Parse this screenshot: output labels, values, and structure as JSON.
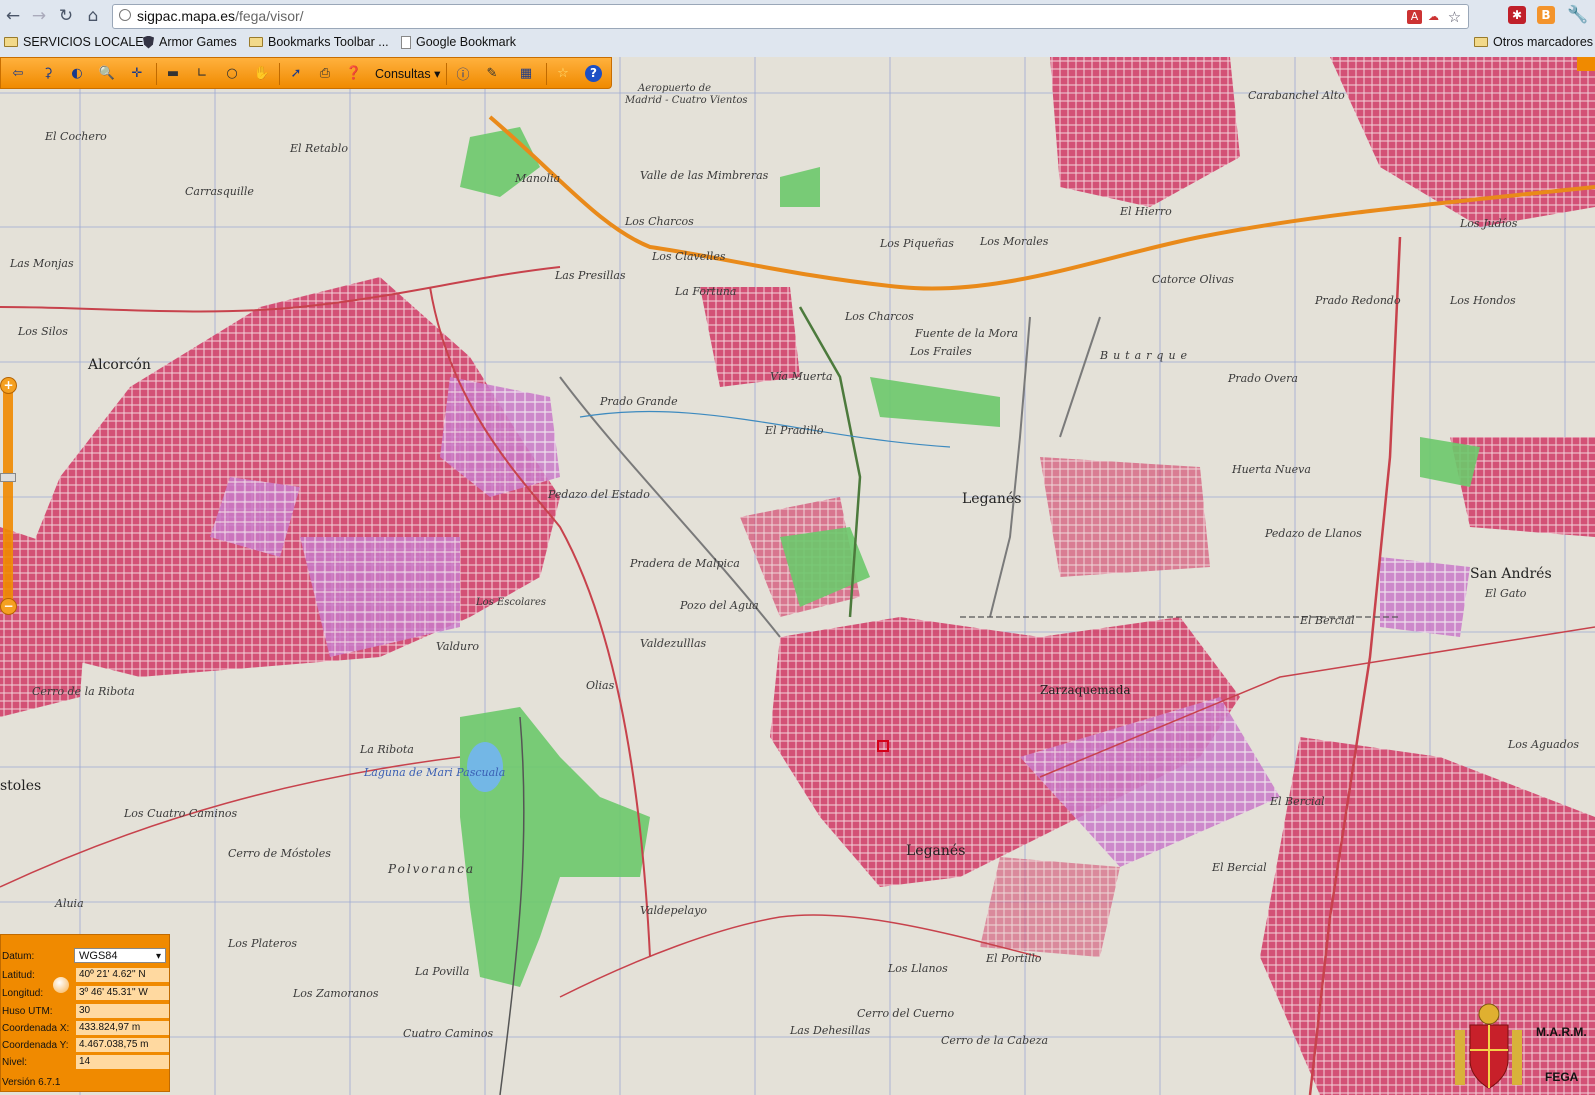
{
  "browser": {
    "url_host": "sigpac.mapa.es",
    "url_path": "/fega/visor/",
    "bookmarks": [
      {
        "label": "SERVICIOS LOCALES",
        "icon": "folder-icon"
      },
      {
        "label": "Armor Games",
        "icon": "shield-icon"
      },
      {
        "label": "Bookmarks Toolbar ...",
        "icon": "folder-icon"
      },
      {
        "label": "Google Bookmark",
        "icon": "page-icon"
      }
    ],
    "other_bookmarks": "Otros marcadores"
  },
  "toolbar": {
    "consultas_label": "Consultas",
    "help_label": "?"
  },
  "map": {
    "places": [
      {
        "text": "Aeropuerto de"
      },
      {
        "text": "Madrid - Cuatro Vientos"
      },
      {
        "text": "Carabanchel Alto"
      },
      {
        "text": "El Cochero"
      },
      {
        "text": "El Retablo"
      },
      {
        "text": "Manolia"
      },
      {
        "text": "Valle de las Mimbreras"
      },
      {
        "text": "Carrasquille"
      },
      {
        "text": "Los Charcos"
      },
      {
        "text": "Las Monjas"
      },
      {
        "text": "Las Presillas"
      },
      {
        "text": "Los Clavelles"
      },
      {
        "text": "La Fortuna"
      },
      {
        "text": "Los Piqueñas"
      },
      {
        "text": "Los Morales"
      },
      {
        "text": "El Hierro"
      },
      {
        "text": "Los Judíos"
      },
      {
        "text": "Catorce Olivas"
      },
      {
        "text": "Prado Redondo"
      },
      {
        "text": "Los Hondos"
      },
      {
        "text": "Los Silos"
      },
      {
        "text": "Alcorcón"
      },
      {
        "text": "Los Charcos"
      },
      {
        "text": "Fuente de la Mora"
      },
      {
        "text": "Los Frailes"
      },
      {
        "text": "Butarque"
      },
      {
        "text": "Vía Muerta"
      },
      {
        "text": "Prado Grande"
      },
      {
        "text": "Prado Overa"
      },
      {
        "text": "El Pradillo"
      },
      {
        "text": "Leganés"
      },
      {
        "text": "Huerta Nueva"
      },
      {
        "text": "Pedazo del Estado"
      },
      {
        "text": "Pedazo de Llanos"
      },
      {
        "text": "Pradera de Malpica"
      },
      {
        "text": "Los Escolares"
      },
      {
        "text": "Pozo del Agua"
      },
      {
        "text": "San Andrés"
      },
      {
        "text": "El Gato"
      },
      {
        "text": "El Bercial"
      },
      {
        "text": "Valduro"
      },
      {
        "text": "Valdezulllas"
      },
      {
        "text": "Cerro de la Ribota"
      },
      {
        "text": "Olias"
      },
      {
        "text": "Zarzaquemada"
      },
      {
        "text": "La Ribota"
      },
      {
        "text": "Laguna de Mari Pascuala"
      },
      {
        "text": "stoles"
      },
      {
        "text": "Los Cuatro Caminos"
      },
      {
        "text": "El Bercial"
      },
      {
        "text": "Los Aguados"
      },
      {
        "text": "Cerro de Móstoles"
      },
      {
        "text": "Polvoranca"
      },
      {
        "text": "Leganés"
      },
      {
        "text": "El Bercial"
      },
      {
        "text": "Aluia"
      },
      {
        "text": "Valdepelayo"
      },
      {
        "text": "Los Plateros"
      },
      {
        "text": "La Povilla"
      },
      {
        "text": "Los Llanos"
      },
      {
        "text": "El Portillo"
      },
      {
        "text": "Los Zamoranos"
      },
      {
        "text": "Cerro del Cuerno"
      },
      {
        "text": "Las Dehesillas"
      },
      {
        "text": "Cuatro Caminos"
      },
      {
        "text": "Cerro de la Cabeza"
      }
    ]
  },
  "info_panel": {
    "datum_label": "Datum:",
    "datum_value": "WGS84",
    "fields": [
      {
        "label": "Latitud:",
        "value": "40º 21' 4.62'' N"
      },
      {
        "label": "Longitud:",
        "value": "3º 46' 45.31'' W"
      },
      {
        "label": "Huso UTM:",
        "value": "30"
      },
      {
        "label": "Coordenada X:",
        "value": "433.824,97 m"
      },
      {
        "label": "Coordenada Y:",
        "value": "4.467.038,75 m"
      },
      {
        "label": "Nivel:",
        "value": "14"
      }
    ],
    "version": "Versión 6.7.1"
  },
  "logo": {
    "marm": "M.A.R.M.",
    "fega": "FEGA"
  },
  "colors": {
    "toolbar_orange": "#f08a00",
    "urban_red": "#d2456d",
    "park_green": "#6cc96b",
    "motorway_orange": "#e98a1a"
  }
}
